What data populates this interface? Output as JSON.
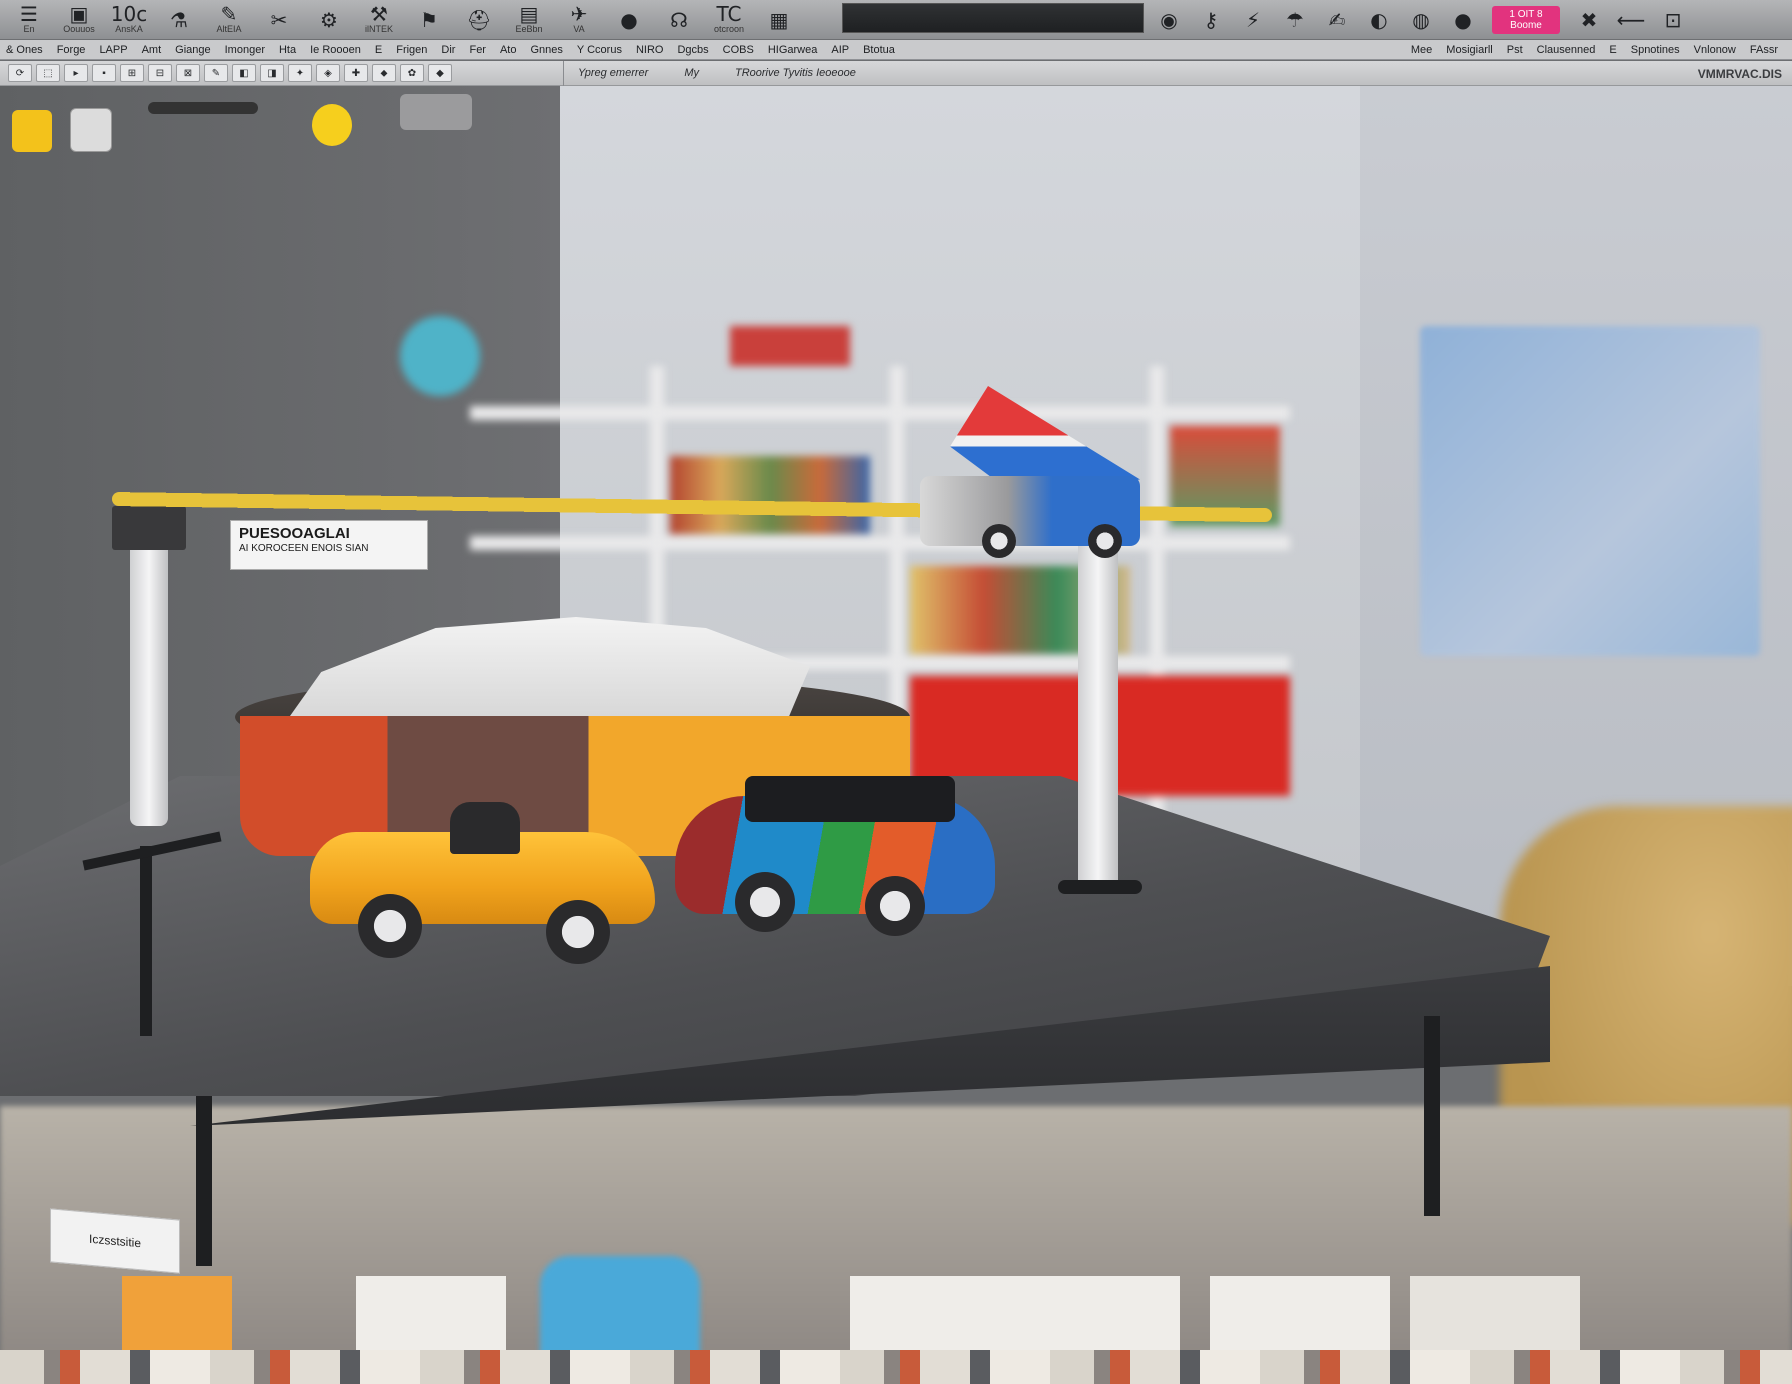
{
  "toolbar": {
    "tools": [
      {
        "glyph": "☰",
        "label": "En"
      },
      {
        "glyph": "▣",
        "label": "Oouuos"
      },
      {
        "glyph": "10c",
        "label": "AnsKA"
      },
      {
        "glyph": "⚗",
        "label": ""
      },
      {
        "glyph": "✎",
        "label": "AltEIA"
      },
      {
        "glyph": "✂",
        "label": ""
      },
      {
        "glyph": "⚙",
        "label": ""
      },
      {
        "glyph": "⚒",
        "label": "ilNTEK"
      },
      {
        "glyph": "⚑",
        "label": ""
      },
      {
        "glyph": "⛑",
        "label": ""
      },
      {
        "glyph": "▤",
        "label": "EeBbn"
      },
      {
        "glyph": "✈",
        "label": "VA"
      },
      {
        "glyph": "●",
        "label": ""
      },
      {
        "glyph": "☊",
        "label": ""
      },
      {
        "glyph": "TC",
        "label": "otcroon"
      },
      {
        "glyph": "▦",
        "label": ""
      }
    ],
    "right_tools": [
      {
        "glyph": "◉",
        "label": ""
      },
      {
        "glyph": "⚷",
        "label": ""
      },
      {
        "glyph": "⚡",
        "label": ""
      },
      {
        "glyph": "☂",
        "label": ""
      },
      {
        "glyph": "✍",
        "label": ""
      },
      {
        "glyph": "◐",
        "label": ""
      },
      {
        "glyph": "◍",
        "label": ""
      },
      {
        "glyph": "●",
        "label": ""
      }
    ],
    "pink_button": {
      "line1": "1 OIT 8",
      "line2": "Boome"
    },
    "right_extra": [
      {
        "glyph": "✖",
        "label": ""
      },
      {
        "glyph": "⟵",
        "label": ""
      },
      {
        "glyph": "⊡",
        "label": ""
      }
    ]
  },
  "menubar": {
    "items": [
      "& Ones",
      "Forge",
      "LAPP",
      "Amt",
      "Giange",
      "Imonger",
      "Hta",
      "Ie Roooen",
      "E",
      "Frigen",
      "Dir",
      "Fer",
      "Ato",
      "Gnnes",
      "Y Ccorus",
      "NIRO",
      "Dgcbs",
      "COBS",
      "HIGarwea",
      "AIP",
      "Btotua"
    ],
    "right_items": [
      "Mee",
      "Mosigiarll",
      "Pst",
      "Clausenned",
      "E",
      "Spnotines",
      "Vnlonow",
      "FAssr"
    ]
  },
  "subbar": {
    "mini_icons": [
      "⟳",
      "⬚",
      "▸",
      "▪",
      "⊞",
      "⊟",
      "⊠",
      "✎",
      "◧",
      "◨",
      "✦",
      "◈",
      "✚",
      "⬥",
      "✿",
      "◆"
    ],
    "tabs": [
      "Ypreg emerrer",
      "My",
      "TRoorive Tyvitis Ieoeooe"
    ],
    "right_text": "VMMRVAC.DIS"
  },
  "scene": {
    "sign_line1": "PUESOOAGLAI",
    "sign_line2": "AI KOROCEEN ENOIS SIAN",
    "table_tag": "Iczsstsitie"
  },
  "colors": {
    "accent_pink": "#e2337e",
    "track_yellow": "#e7c33a",
    "car_yellow": "#f0a21c"
  }
}
